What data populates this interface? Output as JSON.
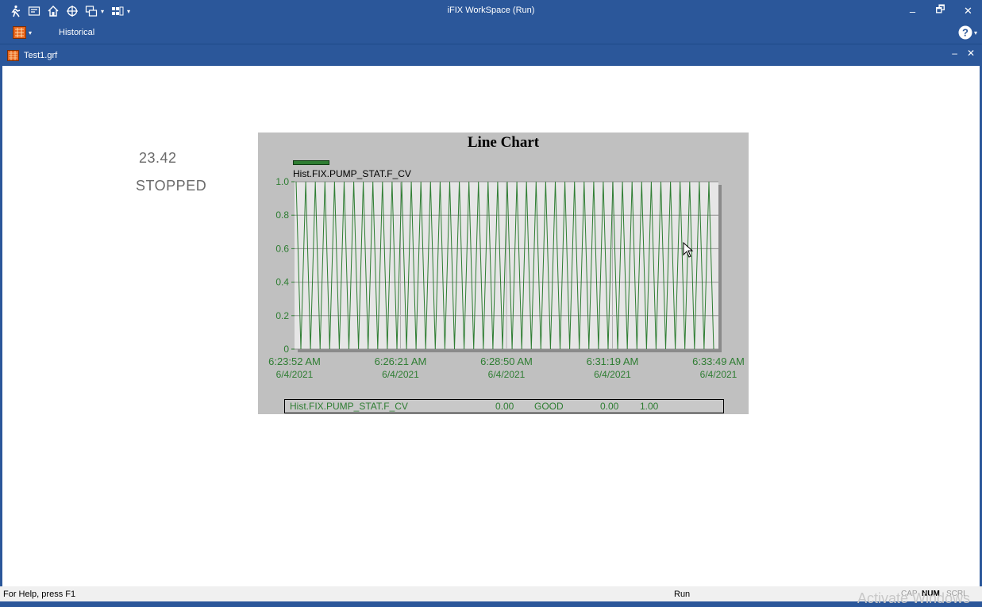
{
  "app": {
    "title": "iFIX WorkSpace (Run)",
    "ribbon_tab": "Historical",
    "accent": "#2b579a"
  },
  "window_controls": {
    "minimize": "–",
    "restore": "🗗",
    "close": "✕"
  },
  "document": {
    "name": "Test1.grf",
    "minimize": "–",
    "close": "✕"
  },
  "help_icon": "?",
  "display": {
    "value": "23.42",
    "state": "STOPPED"
  },
  "chart_data": {
    "type": "line",
    "title": "Line Chart",
    "series": [
      {
        "name": "Hist.FIX.PUMP_STAT.F_CV",
        "color": "#2e7d32",
        "values": [
          1,
          0,
          1,
          0,
          1,
          0,
          1,
          0,
          1,
          0,
          1,
          0,
          1,
          0,
          1,
          0,
          1,
          0,
          1,
          0,
          1,
          0,
          1,
          0,
          1,
          0,
          1,
          0,
          1,
          0,
          1,
          0,
          1,
          0,
          1,
          0,
          1,
          0,
          1,
          0,
          1,
          0,
          1,
          0,
          1,
          0,
          1,
          0,
          1,
          0,
          1,
          0,
          1,
          0,
          1,
          0,
          1,
          0,
          1,
          0,
          1,
          0,
          1,
          0,
          1,
          0,
          1,
          0,
          1,
          0,
          1,
          0,
          1,
          0,
          1,
          0,
          1,
          0,
          1,
          0,
          1,
          0,
          1,
          0,
          1,
          0,
          1,
          0
        ]
      }
    ],
    "ylim": [
      0,
      1
    ],
    "y_ticks": [
      "1.0",
      "0.8",
      "0.6",
      "0.4",
      "0.2",
      "0"
    ],
    "x_ticks": [
      {
        "time": "6:23:52 AM",
        "date": "6/4/2021"
      },
      {
        "time": "6:26:21 AM",
        "date": "6/4/2021"
      },
      {
        "time": "6:28:50 AM",
        "date": "6/4/2021"
      },
      {
        "time": "6:31:19 AM",
        "date": "6/4/2021"
      },
      {
        "time": "6:33:49 AM",
        "date": "6/4/2021"
      }
    ],
    "grid": true,
    "legend": "top-left"
  },
  "tag_table": {
    "tag": "Hist.FIX.PUMP_STAT.F_CV",
    "value": "0.00",
    "quality": "GOOD",
    "low": "0.00",
    "high": "1.00"
  },
  "status": {
    "help": "For Help, press F1",
    "mode": "Run",
    "cap": "CAP",
    "num": "NUM",
    "scrl": "SCRL"
  },
  "watermark": "Activate Windows"
}
